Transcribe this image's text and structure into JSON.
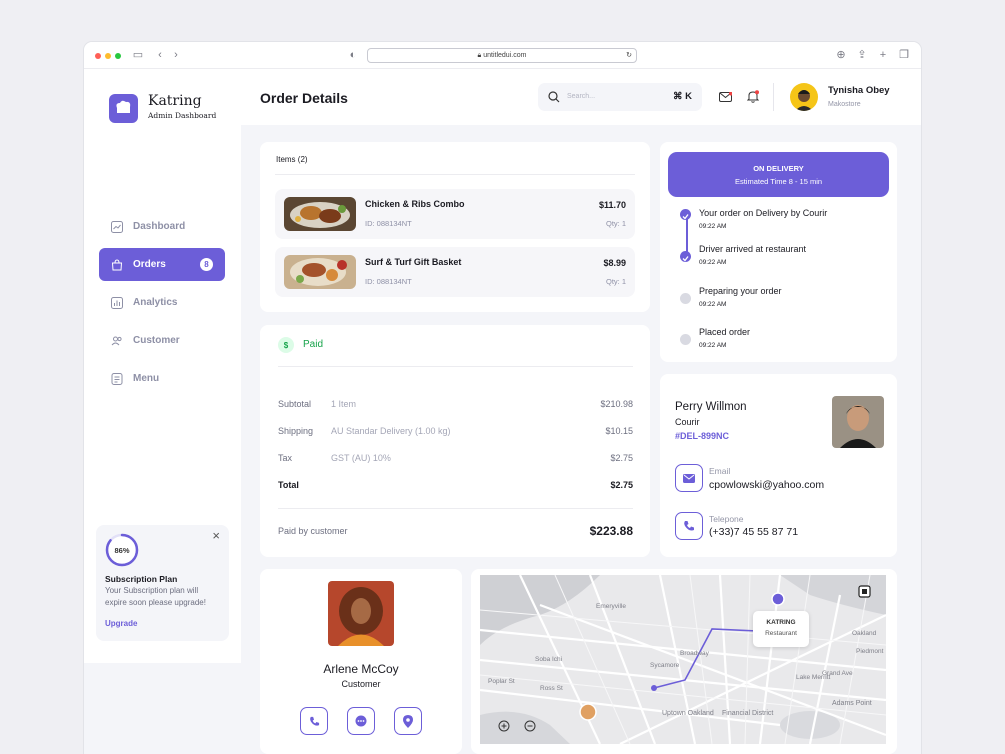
{
  "browser": {
    "url": "untitledui.com"
  },
  "brand": {
    "name": "Katring",
    "subtitle": "Admin Dashboard"
  },
  "nav": [
    {
      "label": "Dashboard",
      "icon": "chart-icon"
    },
    {
      "label": "Orders",
      "icon": "bag-icon",
      "badge": "8",
      "active": true
    },
    {
      "label": "Analytics",
      "icon": "analytics-icon"
    },
    {
      "label": "Customer",
      "icon": "users-icon"
    },
    {
      "label": "Menu",
      "icon": "menu-icon"
    }
  ],
  "subscription": {
    "percent_label": "86%",
    "percent": 0.86,
    "title": "Subscription Plan",
    "text_line1": "Your Subscription plan will",
    "text_line2": "expire soon please upgrade!",
    "link": "Upgrade"
  },
  "header": {
    "title": "Order Details",
    "search_placeholder": "Search...",
    "shortcut": "⌘ K",
    "user_name": "Tynisha Obey",
    "user_role": "Makostore"
  },
  "items": {
    "heading": "Items (2)",
    "rows": [
      {
        "name": "Chicken & Ribs Combo",
        "id": "ID: 088134NT",
        "price": "$11.70",
        "qty": "Qty: 1"
      },
      {
        "name": "Surf & Turf Gift Basket",
        "id": "ID: 088134NT",
        "price": "$8.99",
        "qty": "Qty: 1"
      }
    ]
  },
  "payment": {
    "status": "Paid",
    "rows": [
      {
        "label": "Subtotal",
        "detail": "1 Item",
        "amount": "$210.98"
      },
      {
        "label": "Shipping",
        "detail": "AU Standar Delivery (1.00 kg)",
        "amount": "$10.15"
      },
      {
        "label": "Tax",
        "detail": "GST (AU) 10%",
        "amount": "$2.75"
      },
      {
        "label": "Total",
        "detail": "",
        "amount": "$2.75"
      }
    ],
    "paid_by_label": "Paid by customer",
    "paid_total": "$223.88"
  },
  "delivery": {
    "status": "ON DELIVERY",
    "estimate": "Estimated Time 8 - 15 min",
    "timeline": [
      {
        "text": "Your order on Delivery by Courir",
        "time": "09:22 AM",
        "done": true
      },
      {
        "text": "Driver arrived at restaurant",
        "time": "09:22 AM",
        "done": true
      },
      {
        "text": "Preparing your order",
        "time": "09:22 AM",
        "done": false
      },
      {
        "text": "Placed order",
        "time": "09:22 AM",
        "done": false
      }
    ]
  },
  "courier": {
    "name": "Perry Willmon",
    "role": "Courir",
    "code": "#DEL-899NC",
    "email_label": "Email",
    "email": "cpowlowski@yahoo.com",
    "phone_label": "Telepone",
    "phone": "(+33)7 45 55 87 71"
  },
  "customer": {
    "name": "Arlene McCoy",
    "role": "Customer"
  },
  "map": {
    "pin_title": "KATRING",
    "pin_subtitle": "Restaurant",
    "labels": [
      "Emeryville",
      "Oakland",
      "Piedmont",
      "Soba Ichi",
      "Uptown Oakland",
      "Financial District",
      "Adams Point",
      "Grand Ave",
      "Poplar St",
      "Sycamore",
      "Ross St",
      "Lake Merritt",
      "Broadway"
    ]
  },
  "colors": {
    "accent": "#6c5ed8",
    "paid_green": "#16a34a"
  }
}
